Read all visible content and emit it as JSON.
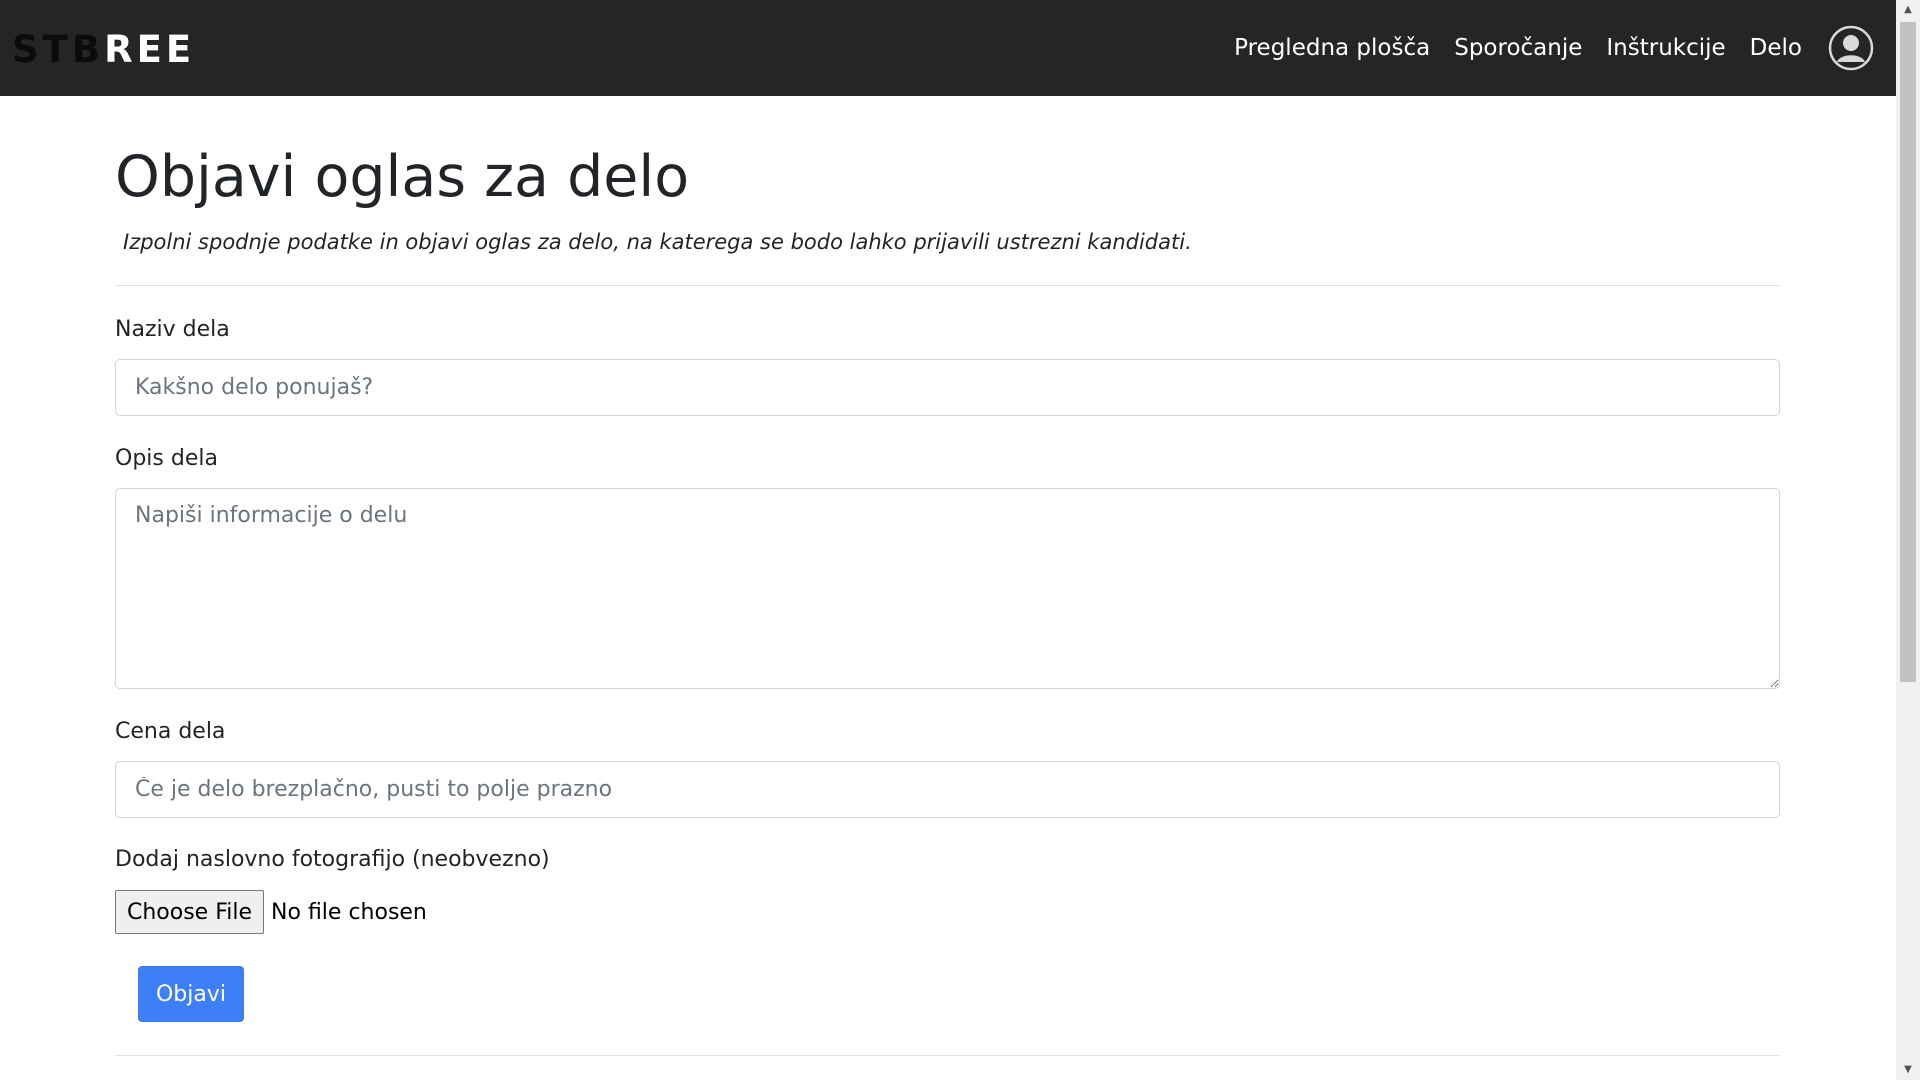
{
  "navbar": {
    "brand_dark": "STB",
    "brand_light": "REE",
    "links": [
      "Pregledna plošča",
      "Sporočanje",
      "Inštrukcije",
      "Delo"
    ],
    "avatar_icon": "user-circle-icon"
  },
  "page": {
    "title": "Objavi oglas za delo",
    "subtitle": "Izpolni spodnje podatke in objavi oglas za delo, na katerega se bodo lahko prijavili ustrezni kandidati."
  },
  "form": {
    "name": {
      "label": "Naziv dela",
      "placeholder": "Kakšno delo ponujaš?",
      "value": ""
    },
    "description": {
      "label": "Opis dela",
      "placeholder": "Napiši informacije o delu",
      "value": ""
    },
    "price": {
      "label": "Cena dela",
      "placeholder": "Če je delo brezplačno, pusti to polje prazno",
      "value": ""
    },
    "photo": {
      "label": "Dodaj naslovno fotografijo (neobvezno)",
      "button_label": "Choose File",
      "status": "No file chosen"
    },
    "submit_label": "Objavi"
  },
  "colors": {
    "navbar_bg": "#252525",
    "primary": "#3d7ff8"
  }
}
